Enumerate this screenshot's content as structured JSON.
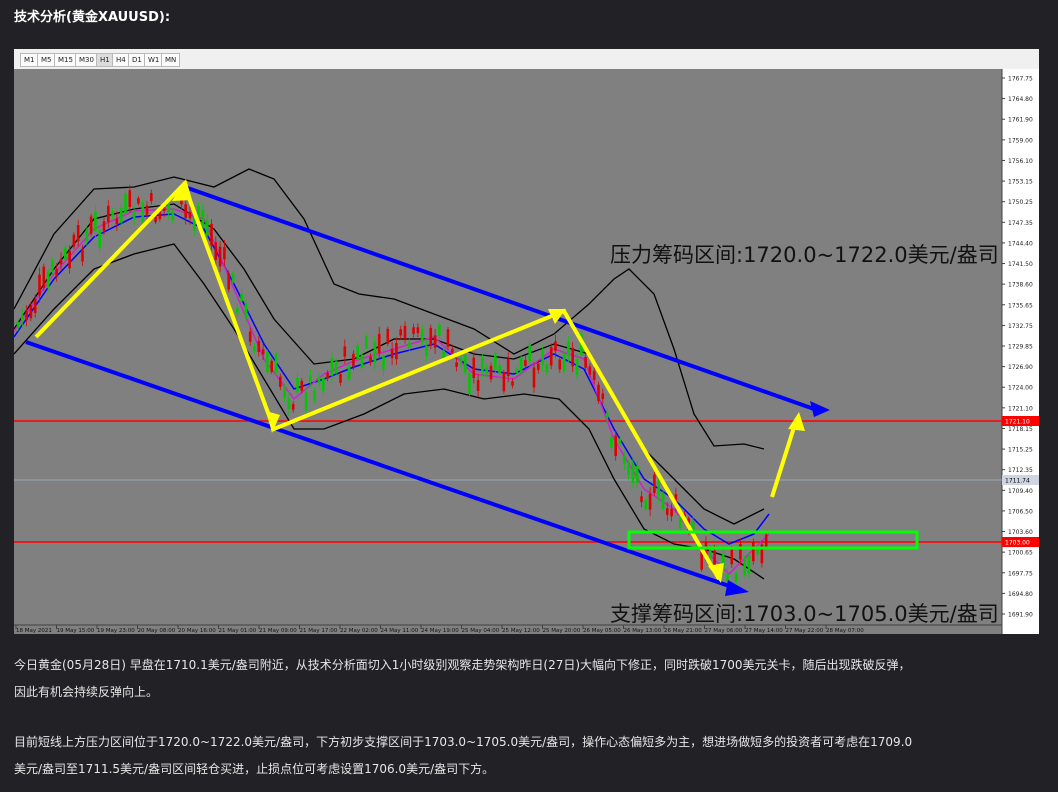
{
  "heading": "技术分析(黄金XAUUSD):",
  "chart": {
    "timeframes": [
      "M1",
      "M5",
      "M15",
      "M30",
      "H1",
      "H4",
      "D1",
      "W1",
      "MN"
    ],
    "price_axis": [
      "1767.75",
      "1764.80",
      "1761.90",
      "1759.00",
      "1756.10",
      "1753.15",
      "1750.25",
      "1747.35",
      "1744.40",
      "1741.50",
      "1738.60",
      "1735.65",
      "1732.75",
      "1729.85",
      "1726.90",
      "1724.00",
      "1721.10",
      "1718.15",
      "1715.25",
      "1712.35",
      "1709.40",
      "1706.50",
      "1703.60",
      "1700.65",
      "1697.75",
      "1694.80",
      "1691.90"
    ],
    "price_tags": [
      "1721.10",
      "1711.74",
      "1703.00"
    ],
    "time_axis": [
      "18 May 2021",
      "19 May 15:00",
      "19 May 23:00",
      "20 May 08:00",
      "20 May 16:00",
      "21 May 01:00",
      "21 May 09:00",
      "21 May 17:00",
      "22 May 02:00",
      "24 May 11:00",
      "24 May 19:00",
      "25 May 04:00",
      "25 May 12:00",
      "25 May 20:00",
      "26 May 05:00",
      "26 May 13:00",
      "26 May 21:00",
      "27 May 06:00",
      "27 May 14:00",
      "27 May 22:00",
      "28 May 07:00"
    ],
    "resistance_label": "压力筹码区间:1720.0~1722.0美元/盎司",
    "support_label": "支撑筹码区间:1703.0~1705.0美元/盎司",
    "colors": {
      "background": "#808080",
      "upper_line": "#ff0000",
      "lower_line": "#ff0000",
      "channel": "#0000ff",
      "arrows": "#ffff00",
      "support_box": "#00ff00"
    }
  },
  "paragraphs": {
    "p1_line1": "今日黄金(05月28日) 早盘在1710.1美元/盎司附近，从技术分析面切入1小时级别观察走势架构昨日(27日)大幅向下修正，同时跌破1700美元关卡，随后出现跌破反弹，",
    "p1_line2": "因此有机会持续反弹向上。",
    "p2_line1": "目前短线上方压力区间位于1720.0~1722.0美元/盎司，下方初步支撑区间于1703.0~1705.0美元/盎司，操作心态偏短多为主，想进场做短多的投资者可考虑在1709.0",
    "p2_line2": "美元/盎司至1711.5美元/盎司区间轻仓买进，止损点位可考虑设置1706.0美元/盎司下方。"
  }
}
